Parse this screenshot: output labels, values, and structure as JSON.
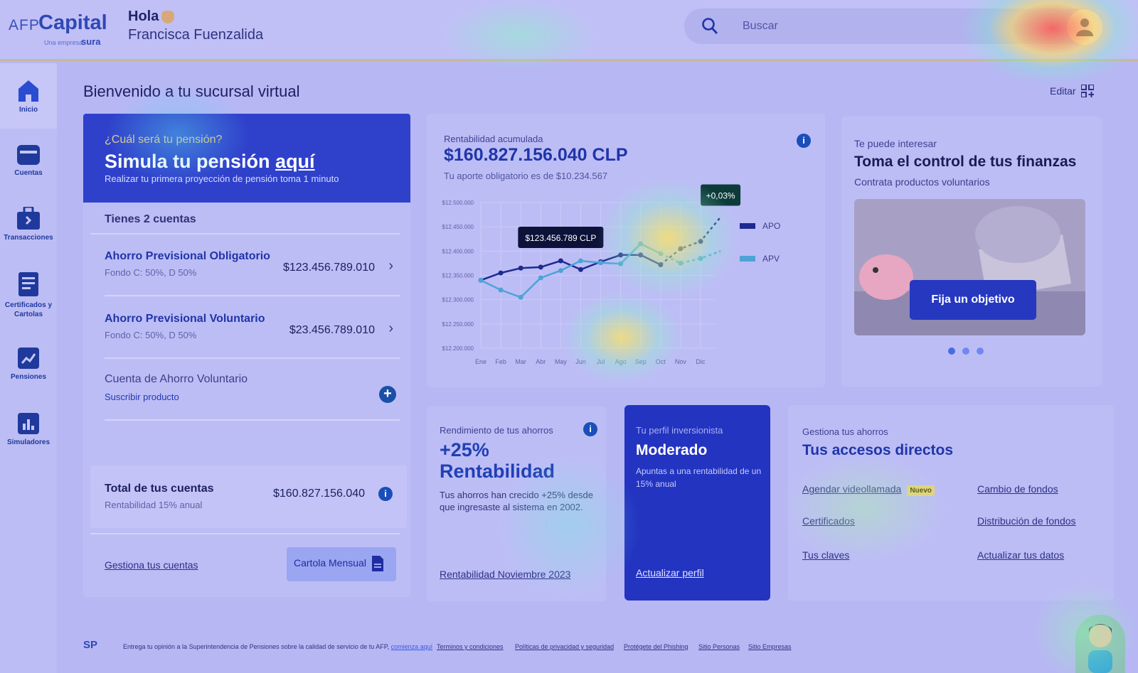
{
  "header": {
    "logo_prefix": "AFP",
    "logo_brand": "Capital",
    "logo_tagline": "Una empresa",
    "logo_parent": "sura",
    "greeting": "Hola",
    "user_name": "Francisca Fuenzalida",
    "search_placeholder": "Buscar"
  },
  "sidebar": {
    "items": [
      {
        "label": "Inicio",
        "icon": "home-icon"
      },
      {
        "label": "Cuentas",
        "icon": "wallet-icon"
      },
      {
        "label": "Transacciones",
        "icon": "briefcase-icon"
      },
      {
        "label": "Certificados y Cartolas",
        "icon": "document-icon"
      },
      {
        "label": "Pensiones",
        "icon": "trend-icon"
      },
      {
        "label": "Simuladores",
        "icon": "bar-chart-icon"
      }
    ]
  },
  "page": {
    "title": "Bienvenido a tu sucursal virtual",
    "edit_label": "Editar"
  },
  "promo": {
    "question": "¿Cuál será tu pensión?",
    "title_prefix": "Simula tu pensión",
    "title_link": "aquí",
    "subtitle": "Realizar tu primera proyección de pensión toma 1 minuto"
  },
  "accounts": {
    "count_label": "Tienes 2 cuentas",
    "items": [
      {
        "name": "Ahorro Previsional Obligatorio",
        "fund": "Fondo C: 50%, D 50%",
        "amount": "$123.456.789.010"
      },
      {
        "name": "Ahorro Previsional Voluntario",
        "fund": "Fondo C: 50%, D 50%",
        "amount": "$23.456.789.010"
      }
    ],
    "extra_name": "Cuenta de Ahorro Voluntario",
    "extra_link": "Suscribir producto",
    "total_label": "Total de tus cuentas",
    "total_sub": "Rentabilidad 15% anual",
    "total_amount": "$160.827.156.040",
    "manage_link": "Gestiona tus cuentas",
    "cartola_button": "Cartola Mensual"
  },
  "rentabilidad": {
    "label": "Rentabilidad acumulada",
    "amount": "$160.827.156.040 CLP",
    "sub": "Tu aporte obligatorio es de $10.234.567"
  },
  "chart_data": {
    "type": "line",
    "categories": [
      "Ene",
      "Feb",
      "Mar",
      "Abr",
      "May",
      "Jun",
      "Jul",
      "Ago",
      "Sep",
      "Oct",
      "Nov",
      "Dic"
    ],
    "yticks": [
      "$12.500.000",
      "$12.450.000",
      "$12.400.000",
      "$12.350.000",
      "$12.300.000",
      "$12.250.000",
      "$12.200.000"
    ],
    "ylim": [
      12200000,
      12500000
    ],
    "series": [
      {
        "name": "APO",
        "color": "#1d2a8f",
        "values": [
          12340000,
          12355000,
          12365000,
          12367000,
          12380000,
          12362000,
          12378000,
          12392000,
          12392000,
          12372000,
          12405000,
          12420000
        ],
        "projected_from": 9,
        "projected_extra": [
          12470000
        ]
      },
      {
        "name": "APV",
        "color": "#4da3d6",
        "values": [
          12340000,
          12320000,
          12305000,
          12345000,
          12360000,
          12380000,
          12376000,
          12374000,
          12415000,
          12395000,
          12375000,
          12385000
        ],
        "projected_from": 9,
        "projected_extra": [
          12400000
        ]
      }
    ],
    "tooltip": "$123.456.789 CLP",
    "badge": "+0,03%"
  },
  "interes": {
    "label": "Te puede interesar",
    "title": "Toma el control de tus finanzas",
    "sub": "Contrata productos voluntarios",
    "button": "Fija un objetivo"
  },
  "rendimiento": {
    "label": "Rendimiento de tus ahorros",
    "value": "+25%",
    "value2": "Rentabilidad",
    "desc": "Tus ahorros han crecido +25% desde que ingresaste al sistema en 2002.",
    "link": "Rentabilidad Noviembre 2023"
  },
  "perfil": {
    "label": "Tu perfil inversionista",
    "value": "Moderado",
    "desc": "Apuntas a una rentabilidad de un 15% anual",
    "link": "Actualizar perfil"
  },
  "accesos": {
    "label": "Gestiona tus ahorros",
    "title": "Tus accesos directos",
    "links": [
      "Agendar videollamada",
      "Cambio de fondos",
      "Certificados",
      "Distribución de fondos",
      "Tus claves",
      "Actualizar tus datos"
    ],
    "badge": "Nuevo"
  },
  "footer": {
    "logo": "SP",
    "text": "Entrega tu opinión a la Superintendencia de Pensiones sobre la calidad de servicio de tu AFP,",
    "text_link": "comienza aquí",
    "links": [
      "Terminos y condiciones",
      "Políticas de privacidad y seguridad",
      "Protégete del Phishing",
      "Sitio Personas",
      "Sitio Empresas"
    ]
  },
  "colors": {
    "primary": "#2f41cb",
    "accent": "#1f35a8",
    "apo": "#1d2a8f",
    "apv": "#4da3d6"
  }
}
